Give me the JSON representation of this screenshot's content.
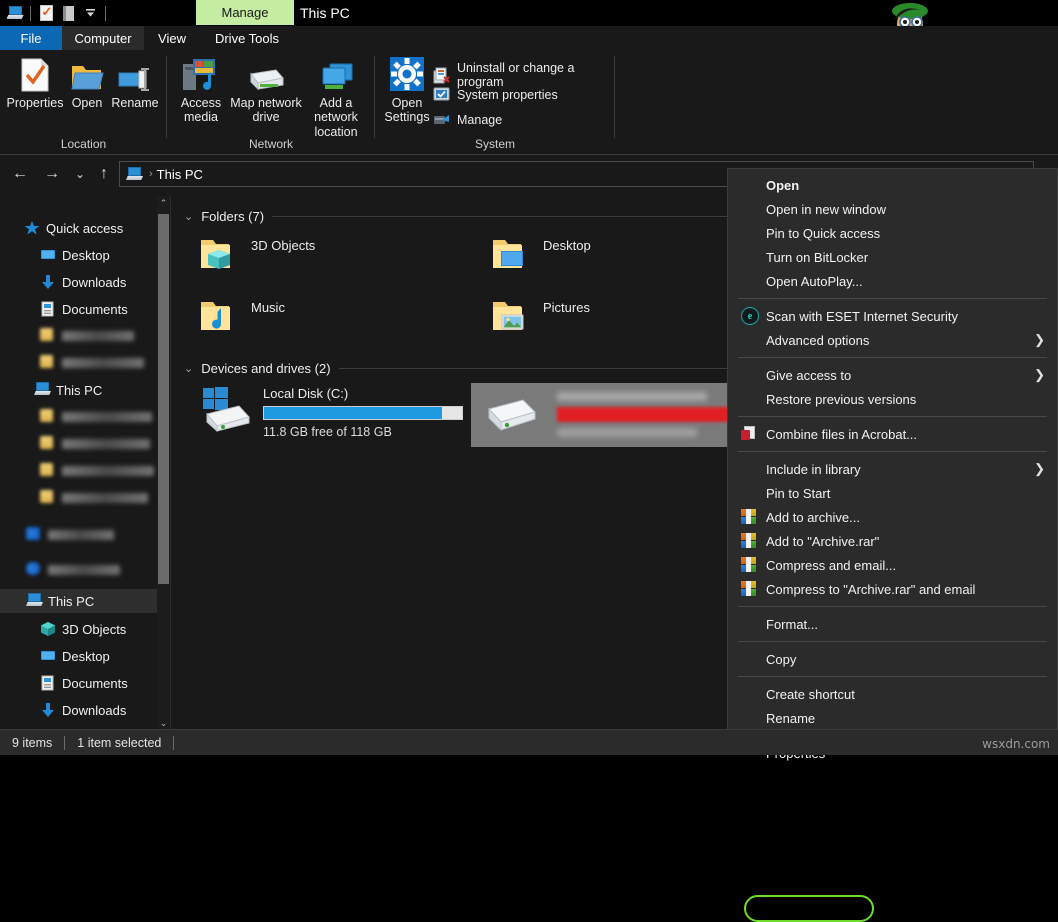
{
  "window": {
    "title": "This PC",
    "manage_tab": "Manage",
    "quick_access_toolbar": [
      {
        "name": "this-pc-icon",
        "label": "This PC"
      },
      {
        "name": "properties-icon",
        "label": "Properties"
      },
      {
        "name": "book-icon",
        "label": "Libraries"
      },
      {
        "name": "customize-chevron-icon",
        "label": "Customize Quick Access Toolbar"
      }
    ]
  },
  "ribbon": {
    "tabs": [
      {
        "label": "File",
        "active": false,
        "accent": "#0c67b4"
      },
      {
        "label": "Computer",
        "active": true
      },
      {
        "label": "View",
        "active": false
      },
      {
        "label": "Drive Tools",
        "active": false
      }
    ],
    "groups": [
      {
        "label": "Location",
        "buttons": [
          {
            "label": "Properties",
            "icon": "properties-icon"
          },
          {
            "label": "Open",
            "icon": "open-folder-icon"
          },
          {
            "label": "Rename",
            "icon": "rename-icon"
          }
        ]
      },
      {
        "label": "Network",
        "buttons": [
          {
            "label": "Access media",
            "icon": "access-media-icon",
            "dropdown": true
          },
          {
            "label": "Map network drive",
            "icon": "map-network-drive-icon",
            "dropdown": true
          },
          {
            "label": "Add a network location",
            "icon": "add-network-location-icon",
            "dropdown": false
          }
        ]
      },
      {
        "label": "System",
        "buttons": [
          {
            "label": "Open Settings",
            "icon": "settings-gear-icon"
          }
        ],
        "small_items": [
          {
            "label": "Uninstall or change a program",
            "icon": "uninstall-program-icon"
          },
          {
            "label": "System properties",
            "icon": "system-properties-icon"
          },
          {
            "label": "Manage",
            "icon": "manage-icon"
          }
        ]
      }
    ]
  },
  "address_bar": {
    "back": "←",
    "forward": "→",
    "recent": "⌄",
    "up": "↑",
    "crumb_icon": "this-pc-icon",
    "crumb_separator": "›",
    "path": "This PC"
  },
  "navigation_pane": {
    "items": [
      {
        "label": "Quick access",
        "icon": "star-icon",
        "indent": 0,
        "pinned": false,
        "blurred": false
      },
      {
        "label": "Desktop",
        "icon": "desktop-icon",
        "indent": 1,
        "pinned": true,
        "blurred": false
      },
      {
        "label": "Downloads",
        "icon": "downloads-icon",
        "indent": 1,
        "pinned": true,
        "blurred": false
      },
      {
        "label": "Documents",
        "icon": "documents-icon",
        "indent": 1,
        "pinned": true,
        "blurred": false
      },
      {
        "label": "",
        "icon": "folder-icon",
        "indent": 1,
        "pinned": true,
        "blurred": true
      },
      {
        "label": "",
        "icon": "folder-icon",
        "indent": 1,
        "pinned": true,
        "blurred": true
      },
      {
        "label": "This PC",
        "icon": "this-pc-icon",
        "indent": 1,
        "pinned": true,
        "blurred": false
      },
      {
        "label": "",
        "icon": "folder-icon",
        "indent": 1,
        "pinned": false,
        "blurred": true
      },
      {
        "label": "",
        "icon": "folder-icon",
        "indent": 1,
        "pinned": false,
        "blurred": true
      },
      {
        "label": "",
        "icon": "folder-icon",
        "indent": 1,
        "pinned": false,
        "blurred": true
      },
      {
        "label": "",
        "icon": "folder-icon",
        "indent": 1,
        "pinned": false,
        "blurred": true
      },
      {
        "label": "",
        "icon": "dropbox-icon",
        "indent": 0,
        "pinned": false,
        "blurred": true
      },
      {
        "label": "",
        "icon": "onedrive-icon",
        "indent": 0,
        "pinned": false,
        "blurred": true
      },
      {
        "label": "This PC",
        "icon": "this-pc-icon",
        "indent": 0,
        "pinned": false,
        "blurred": false,
        "selected": true
      },
      {
        "label": "3D Objects",
        "icon": "3d-objects-icon",
        "indent": 1,
        "pinned": false,
        "blurred": false
      },
      {
        "label": "Desktop",
        "icon": "desktop-icon",
        "indent": 1,
        "pinned": false,
        "blurred": false
      },
      {
        "label": "Documents",
        "icon": "documents-icon",
        "indent": 1,
        "pinned": false,
        "blurred": false
      },
      {
        "label": "Downloads",
        "icon": "downloads-icon",
        "indent": 1,
        "pinned": false,
        "blurred": false
      }
    ]
  },
  "content": {
    "groups": [
      {
        "header": "Folders (7)"
      },
      {
        "header": "Devices and drives (2)"
      }
    ],
    "folders": [
      {
        "label": "3D Objects",
        "icon": "folder-3d-objects-icon"
      },
      {
        "label": "Desktop",
        "icon": "folder-desktop-icon"
      },
      {
        "label": "Music",
        "icon": "folder-music-icon"
      },
      {
        "label": "Pictures",
        "icon": "folder-pictures-icon"
      }
    ],
    "drives": [
      {
        "label": "Local Disk (C:)",
        "icon": "windows-drive-icon",
        "free_text": "11.8 GB free of 118 GB",
        "used_percent": 90,
        "bar_color": "#1e9ae0",
        "selected": false,
        "blurred": false
      },
      {
        "label": "",
        "icon": "drive-icon",
        "free_text": "",
        "used_percent": 88,
        "bar_color": "#e01f24",
        "selected": true,
        "blurred": true
      }
    ]
  },
  "context_menu": {
    "items": [
      {
        "label": "Open",
        "bold": true,
        "icon": null,
        "submenu": false
      },
      {
        "label": "Open in new window",
        "bold": false,
        "icon": null,
        "submenu": false
      },
      {
        "label": "Pin to Quick access",
        "bold": false,
        "icon": null,
        "submenu": false
      },
      {
        "label": "Turn on BitLocker",
        "bold": false,
        "icon": null,
        "submenu": false
      },
      {
        "label": "Open AutoPlay...",
        "bold": false,
        "icon": null,
        "submenu": false
      },
      {
        "separator": true
      },
      {
        "label": "Scan with ESET Internet Security",
        "bold": false,
        "icon": "eset-icon",
        "submenu": false
      },
      {
        "label": "Advanced options",
        "bold": false,
        "icon": null,
        "submenu": true
      },
      {
        "separator": true
      },
      {
        "label": "Give access to",
        "bold": false,
        "icon": null,
        "submenu": true
      },
      {
        "label": "Restore previous versions",
        "bold": false,
        "icon": null,
        "submenu": false
      },
      {
        "separator": true
      },
      {
        "label": "Combine files in Acrobat...",
        "bold": false,
        "icon": "acrobat-icon",
        "submenu": false
      },
      {
        "separator": true
      },
      {
        "label": "Include in library",
        "bold": false,
        "icon": null,
        "submenu": true
      },
      {
        "label": "Pin to Start",
        "bold": false,
        "icon": null,
        "submenu": false
      },
      {
        "label": "Add to archive...",
        "bold": false,
        "icon": "winrar-icon",
        "submenu": false
      },
      {
        "label": "Add to \"Archive.rar\"",
        "bold": false,
        "icon": "winrar-icon",
        "submenu": false
      },
      {
        "label": "Compress and email...",
        "bold": false,
        "icon": "winrar-icon",
        "submenu": false
      },
      {
        "label": "Compress to \"Archive.rar\" and email",
        "bold": false,
        "icon": "winrar-icon",
        "submenu": false
      },
      {
        "separator": true
      },
      {
        "label": "Format...",
        "bold": false,
        "icon": null,
        "submenu": false
      },
      {
        "separator": true
      },
      {
        "label": "Copy",
        "bold": false,
        "icon": null,
        "submenu": false
      },
      {
        "separator": true
      },
      {
        "label": "Create shortcut",
        "bold": false,
        "icon": null,
        "submenu": false
      },
      {
        "label": "Rename",
        "bold": false,
        "icon": null,
        "submenu": false
      },
      {
        "separator": true
      },
      {
        "label": "Properties",
        "bold": false,
        "icon": null,
        "submenu": false,
        "highlighted": true
      }
    ],
    "highlight_color": "#6ddc2c"
  },
  "status_bar": {
    "item_count": "9 items",
    "selection": "1 item selected"
  },
  "watermark": "wsxdn.com"
}
